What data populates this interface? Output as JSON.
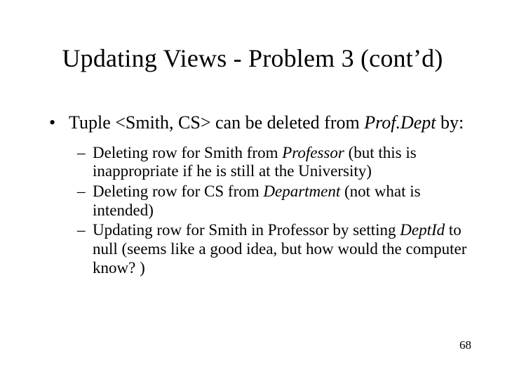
{
  "title": "Updating Views - Problem 3 (cont’d)",
  "bullet": {
    "pre": "Tuple <Smith, CS> can be deleted from ",
    "em": "Prof.Dept",
    "post": " by:"
  },
  "subs": [
    {
      "pre": "Deleting row for Smith from ",
      "em": "Professor",
      "post": " (but this is inappropriate if he is still at the University)"
    },
    {
      "pre": "Deleting row for CS from ",
      "em": "Department",
      "post": " (not what is intended)"
    },
    {
      "pre": "Updating row for Smith in Professor by setting ",
      "em": "DeptId",
      "post": " to null (seems like a good idea, but how would the computer know? )"
    }
  ],
  "page": "68"
}
